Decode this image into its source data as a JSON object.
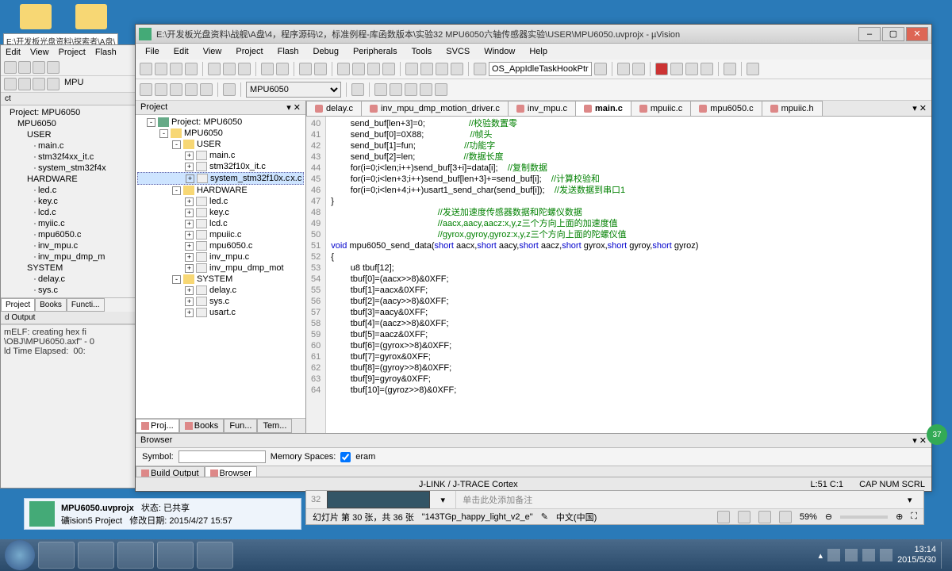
{
  "desktop": {
    "folder_path": "E:\\开发板光盘资料\\探索者\\A盘\\"
  },
  "bg_window": {
    "menu": [
      "Edit",
      "View",
      "Project",
      "Flash"
    ],
    "target": "MPU",
    "panel": {
      "project_hdr": "ct",
      "project_label": "Project: MPU6050"
    },
    "tree": {
      "target": "MPU6050",
      "groups": [
        {
          "name": "USER",
          "files": [
            "main.c",
            "stm32f4xx_it.c",
            "system_stm32f4x"
          ]
        },
        {
          "name": "HARDWARE",
          "files": [
            "led.c",
            "key.c",
            "lcd.c",
            "myiic.c",
            "mpu6050.c",
            "inv_mpu.c",
            "inv_mpu_dmp_m"
          ]
        },
        {
          "name": "SYSTEM",
          "files": [
            "delay.c",
            "sys.c"
          ]
        }
      ]
    },
    "bottom_tabs": [
      "Project",
      "Books",
      "Functi..."
    ],
    "build_hdr": "d Output",
    "build_lines": [
      "mELF: creating hex fi",
      "\\OBJ\\MPU6050.axf\" - 0",
      "ld Time Elapsed:  00:"
    ]
  },
  "window": {
    "title": "E:\\开发板光盘资料\\战舰\\A盘\\4，程序源码\\2，标准例程-库函数版本\\实验32 MPU6050六轴传感器实验\\USER\\MPU6050.uvprojx - µVision",
    "min": "–",
    "max": "▢",
    "close": "✕"
  },
  "menu": [
    "File",
    "Edit",
    "View",
    "Project",
    "Flash",
    "Debug",
    "Peripherals",
    "Tools",
    "SVCS",
    "Window",
    "Help"
  ],
  "toolbar": {
    "search": "OS_AppIdleTaskHookPtr",
    "target": "MPU6050"
  },
  "project_panel": {
    "header": "Project",
    "root": "Project: MPU6050",
    "target": "MPU6050",
    "groups": [
      {
        "name": "USER",
        "files": [
          "main.c",
          "stm32f10x_it.c",
          "system_stm32f10x.c"
        ]
      },
      {
        "name": "HARDWARE",
        "files": [
          "led.c",
          "key.c",
          "lcd.c",
          "mpuiic.c",
          "mpu6050.c",
          "inv_mpu.c",
          "inv_mpu_dmp_mot"
        ]
      },
      {
        "name": "SYSTEM",
        "files": [
          "delay.c",
          "sys.c",
          "usart.c"
        ]
      }
    ],
    "selected_file": "system_stm32f10x.c",
    "tabs": [
      "Proj...",
      "Books",
      "Fun...",
      "Tem..."
    ]
  },
  "editor": {
    "tabs": [
      {
        "name": "delay.c",
        "active": false
      },
      {
        "name": "inv_mpu_dmp_motion_driver.c",
        "active": false
      },
      {
        "name": "inv_mpu.c",
        "active": false
      },
      {
        "name": "main.c",
        "active": true
      },
      {
        "name": "mpuiic.c",
        "active": false
      },
      {
        "name": "mpu6050.c",
        "active": false
      },
      {
        "name": "mpuiic.h",
        "active": false
      }
    ],
    "first_line": 40,
    "lines": [
      {
        "code": "        send_buf[len+3]=0;",
        "comment": "//校验数置零"
      },
      {
        "code": "        send_buf[0]=0X88;",
        "comment": "//帧头"
      },
      {
        "code": "        send_buf[1]=fun;",
        "comment": "//功能字"
      },
      {
        "code": "        send_buf[2]=len;",
        "comment": "//数据长度"
      },
      {
        "code": "        for(i=0;i<len;i++)send_buf[3+i]=data[i];",
        "comment": "//复制数据"
      },
      {
        "code": "        for(i=0;i<len+3;i++)send_buf[len+3]+=send_buf[i];",
        "comment": "//计算校验和"
      },
      {
        "code": "        for(i=0;i<len+4;i++)usart1_send_char(send_buf[i]);",
        "comment": "//发送数据到串口1"
      },
      {
        "code": "}",
        "comment": ""
      },
      {
        "code": "",
        "comment": "//发送加速度传感器数据和陀螺仪数据"
      },
      {
        "code": "",
        "comment": "//aacx,aacy,aacz:x,y,z三个方向上面的加速度值"
      },
      {
        "code": "",
        "comment": "//gyrox,gyroy,gyroz:x,y,z三个方向上面的陀螺仪值"
      },
      {
        "code": "void mpu6050_send_data(short aacx,short aacy,short aacz,short gyrox,short gyroy,short gyroz)",
        "comment": "",
        "sig": true
      },
      {
        "code": "{",
        "comment": ""
      },
      {
        "code": "        u8 tbuf[12];",
        "comment": ""
      },
      {
        "code": "        tbuf[0]=(aacx>>8)&0XFF;",
        "comment": ""
      },
      {
        "code": "        tbuf[1]=aacx&0XFF;",
        "comment": ""
      },
      {
        "code": "        tbuf[2]=(aacy>>8)&0XFF;",
        "comment": ""
      },
      {
        "code": "        tbuf[3]=aacy&0XFF;",
        "comment": ""
      },
      {
        "code": "        tbuf[4]=(aacz>>8)&0XFF;",
        "comment": ""
      },
      {
        "code": "        tbuf[5]=aacz&0XFF;",
        "comment": ""
      },
      {
        "code": "        tbuf[6]=(gyrox>>8)&0XFF;",
        "comment": ""
      },
      {
        "code": "        tbuf[7]=gyrox&0XFF;",
        "comment": ""
      },
      {
        "code": "        tbuf[8]=(gyroy>>8)&0XFF;",
        "comment": ""
      },
      {
        "code": "        tbuf[9]=gyroy&0XFF;",
        "comment": ""
      },
      {
        "code": "        tbuf[10]=(gyroz>>8)&0XFF;",
        "comment": ""
      }
    ]
  },
  "browser": {
    "header": "Browser",
    "symbol_label": "Symbol:",
    "symbol_value": "",
    "mem_label": "Memory Spaces:",
    "mem_check": "eram",
    "tabs": [
      "Build Output",
      "Browser"
    ]
  },
  "status": {
    "debug": "J-LINK / J-TRACE Cortex",
    "pos": "L:51 C:1",
    "caps": "CAP  NUM  SCRL"
  },
  "ppt": {
    "slide_num": "32",
    "note_placeholder": "单击此处添加备注",
    "counter": "幻灯片 第 30 张，共 36 张",
    "theme": "\"143TGp_happy_light_v2_e\"",
    "lang": "中文(中国)",
    "zoom": "59%"
  },
  "file_info": {
    "name": "MPU6050.uvprojx",
    "type": "礦ision5 Project",
    "status_label": "状态:",
    "status": "已共享",
    "date_label": "修改日期:",
    "date": "2015/4/27 15:57"
  },
  "taskbar": {
    "time": "13:14",
    "date": "2015/5/30"
  }
}
